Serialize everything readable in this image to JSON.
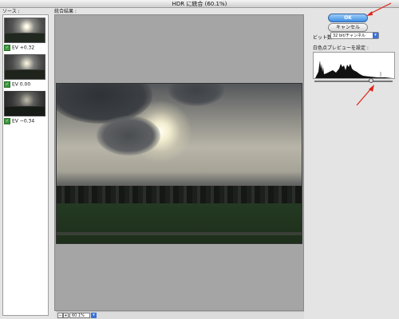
{
  "window": {
    "title": "HDR に統合 (60.1%)"
  },
  "sources": {
    "label": "ソース :",
    "items": [
      {
        "ev": "EV +0.32",
        "checked": true
      },
      {
        "ev": "EV 0.00",
        "checked": true
      },
      {
        "ev": "EV −0.34",
        "checked": true
      }
    ]
  },
  "preview": {
    "label": "統合結果 :"
  },
  "buttons": {
    "ok": "OK",
    "cancel": "キャンセル"
  },
  "settings": {
    "bit_depth_label": "ビット数 :",
    "bit_depth_value": "32 bit/チャンネル",
    "white_point_label": "白色点プレビューを設定 :"
  },
  "zoom": {
    "value": "60.1%"
  },
  "colors": {
    "ok_button": "#3e8ee6",
    "annotation_arrow": "#e2231a",
    "checkbox": "#3b9a3b"
  }
}
